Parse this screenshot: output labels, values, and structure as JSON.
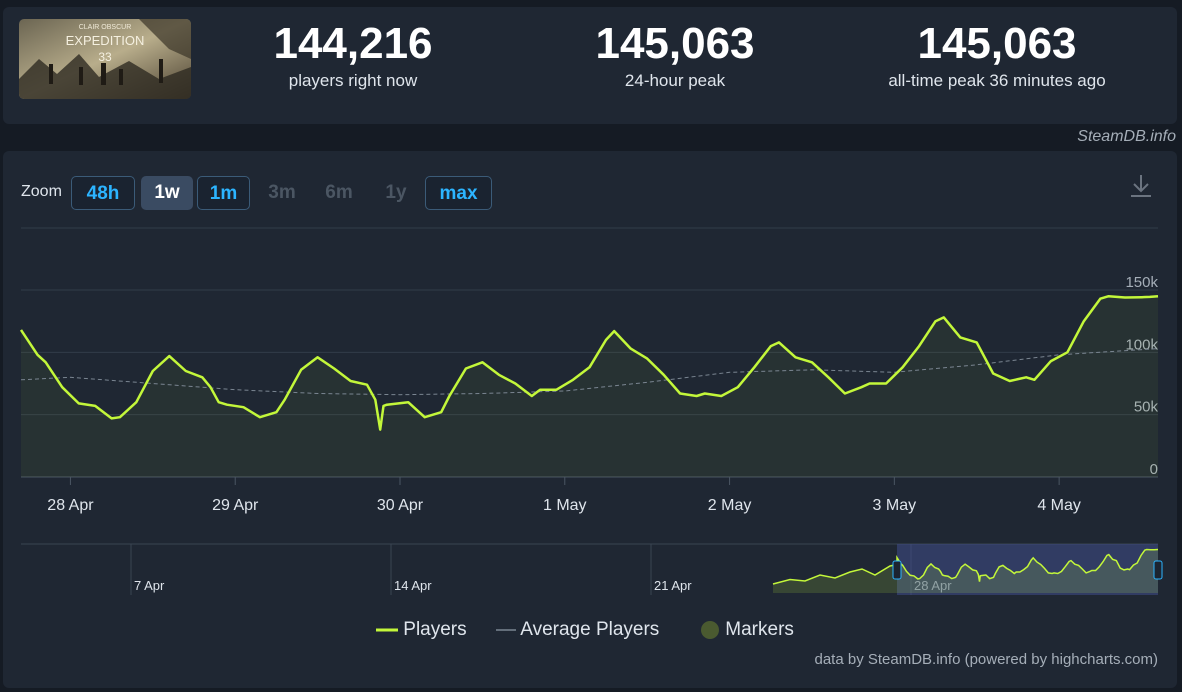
{
  "stats": {
    "current": {
      "value": "144,216",
      "label": "players right now"
    },
    "peak24": {
      "value": "145,063",
      "label": "24-hour peak"
    },
    "alltime": {
      "value": "145,063",
      "label": "all-time peak 36 minutes ago"
    }
  },
  "thumbnail": {
    "small_text": "CLAIR OBSCUR",
    "title": "EXPEDITION",
    "number": "33"
  },
  "credit_top": "SteamDB.info",
  "zoom": {
    "label": "Zoom",
    "buttons": [
      {
        "label": "48h",
        "state": "enabled"
      },
      {
        "label": "1w",
        "state": "active"
      },
      {
        "label": "1m",
        "state": "enabled"
      },
      {
        "label": "3m",
        "state": "disabled"
      },
      {
        "label": "6m",
        "state": "disabled"
      },
      {
        "label": "1y",
        "state": "disabled"
      },
      {
        "label": "max",
        "state": "enabled"
      }
    ]
  },
  "colors": {
    "players": "#c3f73a",
    "average": "#7a8591",
    "markers": "#4a5a30",
    "navigator_fill": "#3f4f8a",
    "link": "#2cb4ff"
  },
  "legend": {
    "players": "Players",
    "average": "Average Players",
    "markers": "Markers"
  },
  "credit_bottom": "data by SteamDB.info (powered by highcharts.com)",
  "chart_data": {
    "type": "line",
    "x_ticks": [
      "28 Apr",
      "29 Apr",
      "30 Apr",
      "1 May",
      "2 May",
      "3 May",
      "4 May"
    ],
    "y_ticks": [
      "0",
      "50k",
      "100k",
      "150k"
    ],
    "ylim": [
      0,
      150000
    ],
    "x_range_days": [
      27.7,
      34.6
    ],
    "series": [
      {
        "name": "Players",
        "x": [
          27.7,
          27.8,
          27.85,
          27.95,
          28.05,
          28.15,
          28.25,
          28.3,
          28.4,
          28.5,
          28.6,
          28.7,
          28.8,
          28.85,
          28.9,
          28.95,
          29.05,
          29.15,
          29.25,
          29.3,
          29.4,
          29.5,
          29.6,
          29.7,
          29.8,
          29.85,
          29.88,
          29.9,
          29.92,
          30.05,
          30.15,
          30.25,
          30.3,
          30.4,
          30.5,
          30.6,
          30.7,
          30.8,
          30.85,
          30.95,
          31.05,
          31.15,
          31.25,
          31.3,
          31.4,
          31.5,
          31.6,
          31.7,
          31.8,
          31.85,
          31.95,
          32.05,
          32.15,
          32.25,
          32.3,
          32.4,
          32.5,
          32.6,
          32.7,
          32.8,
          32.85,
          32.95,
          33.05,
          33.15,
          33.25,
          33.3,
          33.4,
          33.5,
          33.6,
          33.7,
          33.8,
          33.85,
          33.95,
          34.05,
          34.15,
          34.25,
          34.3,
          34.4,
          34.5,
          34.55,
          34.6
        ],
        "values": [
          118000,
          98000,
          92000,
          72000,
          59000,
          57000,
          47000,
          48000,
          60000,
          85000,
          97000,
          85000,
          80000,
          72000,
          60000,
          58000,
          56000,
          48000,
          52000,
          62000,
          86000,
          96000,
          87000,
          77000,
          74000,
          62000,
          38000,
          57000,
          58000,
          60000,
          48000,
          52000,
          65000,
          87000,
          92000,
          82000,
          75000,
          65000,
          70000,
          70000,
          78000,
          88000,
          110000,
          117000,
          103000,
          95000,
          82000,
          67000,
          65000,
          67000,
          65000,
          72000,
          88000,
          105000,
          108000,
          96000,
          92000,
          80000,
          67000,
          72000,
          75000,
          75000,
          88000,
          105000,
          125000,
          128000,
          112000,
          108000,
          83000,
          77000,
          80000,
          78000,
          93000,
          100000,
          125000,
          143000,
          145000,
          144000,
          144216,
          144500,
          145063
        ]
      },
      {
        "name": "Average Players",
        "x": [
          27.7,
          28.0,
          28.5,
          29.0,
          29.5,
          30.0,
          30.5,
          31.0,
          31.5,
          32.0,
          32.5,
          33.0,
          33.5,
          34.0,
          34.6
        ],
        "values": [
          78000,
          80000,
          75000,
          70000,
          67000,
          66000,
          67000,
          69000,
          76000,
          84000,
          86000,
          84000,
          90000,
          98000,
          103000
        ]
      }
    ],
    "navigator": {
      "x_ticks": [
        "7 Apr",
        "14 Apr",
        "21 Apr",
        "28 Apr"
      ]
    },
    "grid": true,
    "legend_position": "bottom-center"
  }
}
